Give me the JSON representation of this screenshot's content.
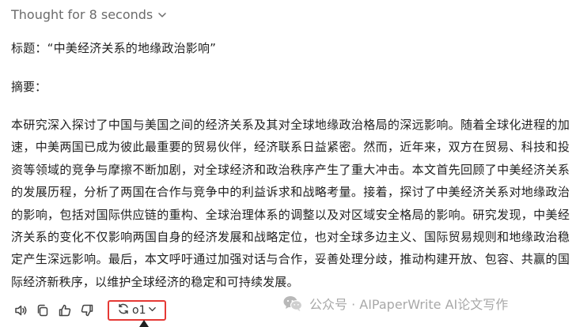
{
  "thought_toggle": {
    "label": "Thought for 8 seconds",
    "icon": "chevron-down-icon"
  },
  "message": {
    "title_line": "标题：“中美经济关系的地缘政治影响”",
    "abstract_label": "摘要：",
    "abstract_text": "本研究深入探讨了中国与美国之间的经济关系及其对全球地缘政治格局的深远影响。随着全球化进程的加速，中美两国已成为彼此最重要的贸易伙伴，经济联系日益紧密。然而，近年来，双方在贸易、科技和投资等领域的竞争与摩擦不断加剧，对全球经济和政治秩序产生了重大冲击。本文首先回顾了中美经济关系的发展历程，分析了两国在合作与竞争中的利益诉求和战略考量。接着，探讨了中美经济关系对地缘政治的影响，包括对国际供应链的重构、全球治理体系的调整以及对区域安全格局的影响。研究发现，中美经济关系的变化不仅影响两国自身的经济发展和战略定位，也对全球多边主义、国际贸易规则和地缘政治稳定产生深远影响。最后，本文呼吁通过加强对话与合作，妥善处理分歧，推动构建开放、包容、共赢的国际经济新秩序，以维护全球经济的稳定和可持续发展。"
  },
  "toolbar": {
    "buttons": [
      {
        "name": "read-aloud-button",
        "icon": "speaker-icon"
      },
      {
        "name": "copy-button",
        "icon": "copy-icon"
      },
      {
        "name": "thumbs-up-button",
        "icon": "thumbs-up-icon"
      },
      {
        "name": "thumbs-down-button",
        "icon": "thumbs-down-icon"
      }
    ],
    "model_selector": {
      "label": "o1",
      "icon": "regenerate-icon",
      "highlight_color": "#e53935"
    }
  },
  "watermark": {
    "text": "公众号 · AIPaperWrite AI论文写作",
    "icon": "wechat-icon"
  }
}
